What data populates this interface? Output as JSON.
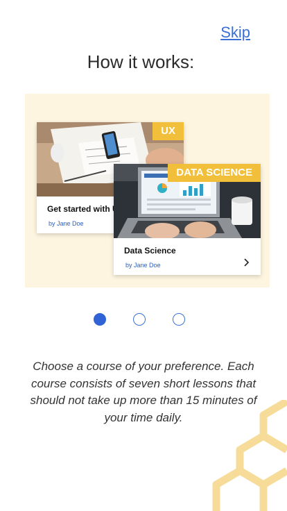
{
  "header": {
    "skip_label": "Skip",
    "title": "How it works:"
  },
  "cards": [
    {
      "badge": "UX",
      "title": "Get started with U",
      "author": "by Jane Doe"
    },
    {
      "badge": "DATA SCIENCE",
      "title": "Data Science",
      "author": "by Jane Doe"
    }
  ],
  "pagination": {
    "count": 3,
    "active_index": 0
  },
  "description": "Choose a course of your preference. Each course consists of seven short lessons that should not take up more than 15 minutes of your time daily.",
  "colors": {
    "accent": "#2f63d6",
    "badge": "#f1bf3a",
    "stage": "#fdf5df",
    "decor": "#f6dc98"
  },
  "icons": [
    "chevron-right-icon",
    "hexagon-decoration"
  ]
}
